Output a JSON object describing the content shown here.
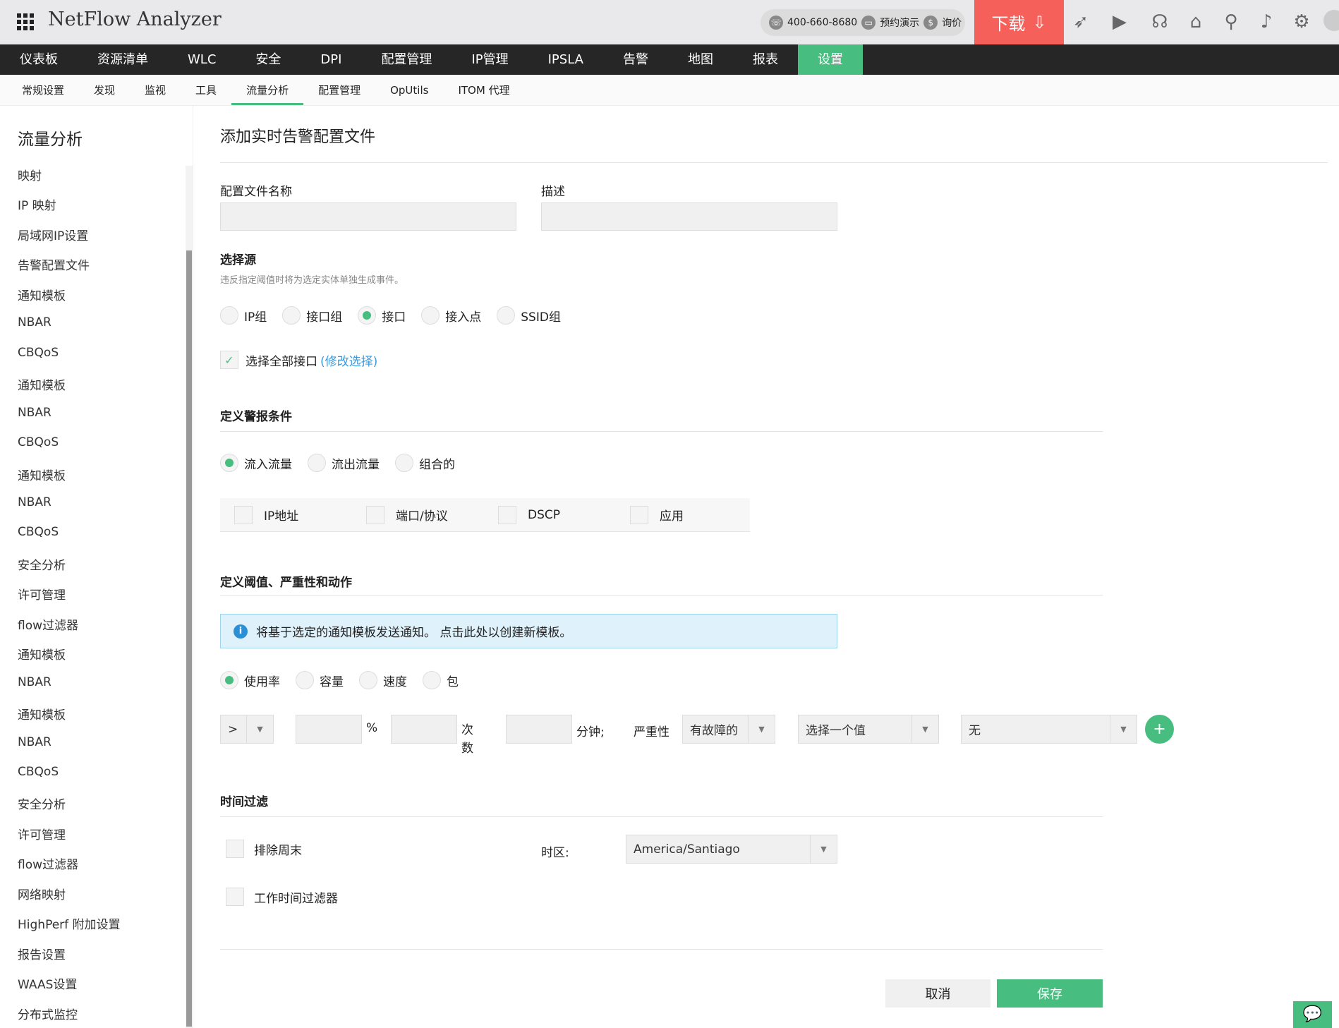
{
  "header": {
    "app_title": "NetFlow Analyzer",
    "phone": "400-660-8680",
    "demo": "预约演示",
    "price": "询价",
    "download": "下载"
  },
  "nav": [
    "仪表板",
    "资源清单",
    "WLC",
    "安全",
    "DPI",
    "配置管理",
    "IP管理",
    "IPSLA",
    "告警",
    "地图",
    "报表",
    "设置"
  ],
  "subnav": [
    "常规设置",
    "发现",
    "监视",
    "工具",
    "流量分析",
    "配置管理",
    "OpUtils",
    "ITOM 代理"
  ],
  "sidebar": {
    "title": "流量分析",
    "items": [
      "映射",
      "IP 映射",
      "局域网IP设置",
      "告警配置文件",
      "通知模板",
      "NBAR",
      "CBQoS",
      "通知模板",
      "NBAR",
      "CBQoS",
      "通知模板",
      "NBAR",
      "CBQoS",
      "安全分析",
      "许可管理",
      "flow过滤器",
      "通知模板",
      "NBAR",
      "通知模板",
      "NBAR",
      "CBQoS",
      "安全分析",
      "许可管理",
      "flow过滤器",
      "网络映射",
      "HighPerf 附加设置",
      "报告设置",
      "WAAS设置",
      "分布式监控"
    ]
  },
  "form": {
    "title": "添加实时告警配置文件",
    "name_label": "配置文件名称",
    "name_value": "",
    "desc_label": "描述",
    "desc_value": "",
    "source_heading": "选择源",
    "source_desc": "违反指定阈值时将为选定实体单独生成事件。",
    "source_options": [
      "IP组",
      "接口组",
      "接口",
      "接入点",
      "SSID组"
    ],
    "source_selected": 2,
    "select_all": "选择全部接口",
    "modify": "(修改选择)",
    "cond_heading": "定义警报条件",
    "traffic_options": [
      "流入流量",
      "流出流量",
      "组合的"
    ],
    "traffic_selected": 0,
    "filters": [
      "IP地址",
      "端口/协议",
      "DSCP",
      "应用"
    ],
    "threshold_heading": "定义阈值、严重性和动作",
    "info": "将基于选定的通知模板发送通知。 点击此处以创建新模板。",
    "metric_options": [
      "使用率",
      "容量",
      "速度",
      "包"
    ],
    "metric_selected": 0,
    "operator": ">",
    "percent": "%",
    "times": "次数",
    "minutes": "分钟;",
    "severity_label": "严重性",
    "severity": "有故障的",
    "select_value": "选择一个值",
    "none": "无",
    "time_heading": "时间过滤",
    "exclude_weekend": "排除周末",
    "timezone_label": "时区:",
    "timezone": "America/Santiago",
    "work_hours": "工作时间过滤器",
    "cancel": "取消",
    "save": "保存"
  },
  "colors": {
    "accent": "#47be80",
    "download": "#f5605a",
    "nav_bg": "#262626"
  }
}
